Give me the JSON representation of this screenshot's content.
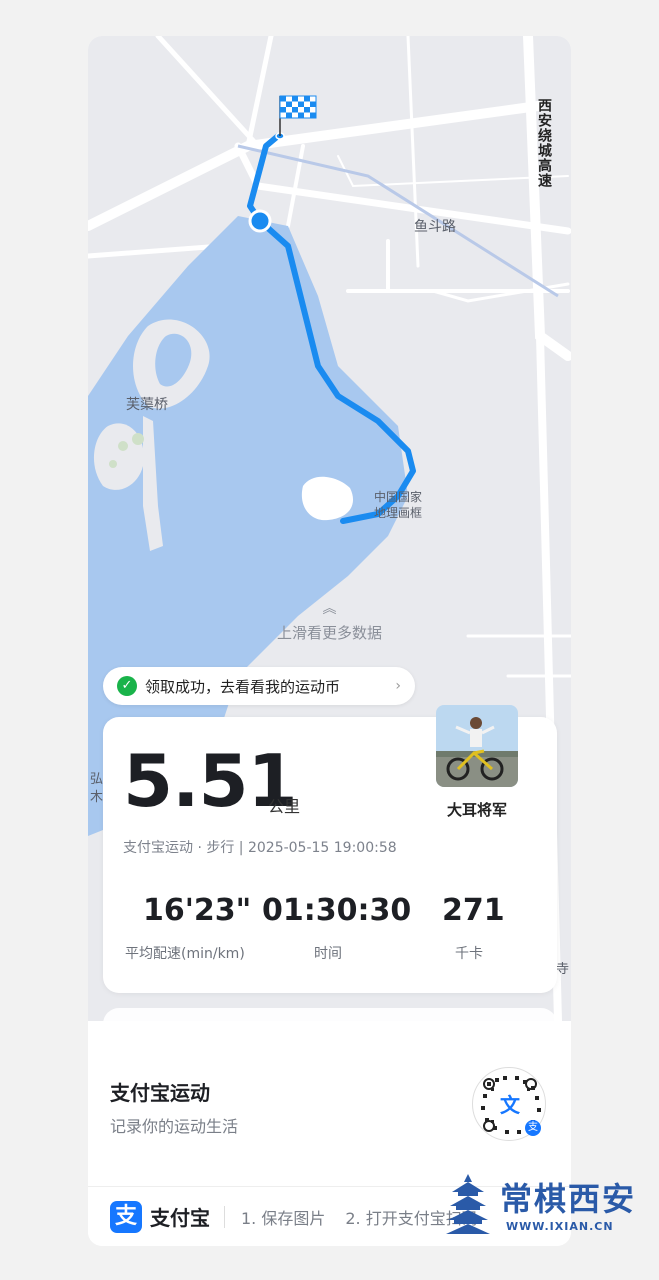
{
  "map": {
    "labels": {
      "highway": "西安绕城高速",
      "road": "鱼斗路",
      "bridge": "芙蕖桥",
      "landmark_line1": "中国国家",
      "landmark_line2": "地理画框",
      "edge_left_1": "弘",
      "edge_left_2": "木",
      "edge_right": "寺"
    },
    "swipe_hint": "上滑看更多数据"
  },
  "coin_pill": {
    "text": "领取成功，去看看我的运动币"
  },
  "stats": {
    "distance": "5.51",
    "distance_unit": "公里",
    "meta": "支付宝运动 · 步行 | 2025-05-15 19:00:58",
    "username": "大耳将军",
    "metrics": [
      {
        "value": "16'23\"",
        "label": "平均配速(min/km)"
      },
      {
        "value": "01:30:30",
        "label": "时间"
      },
      {
        "value": "271",
        "label": "千卡"
      }
    ]
  },
  "footer": {
    "app_title": "支付宝运动",
    "app_subtitle": "记录你的运动生活",
    "qr_glyph": "文",
    "qr_badge": "支",
    "logo_glyph": "支",
    "brand": "支付宝",
    "steps": [
      "1. 保存图片",
      "2. 打开支付宝扫码"
    ]
  },
  "watermark": {
    "text": "常棋西安",
    "url": "WWW.IXIAN.CN"
  },
  "colors": {
    "water": "#a8c8ef",
    "route": "#1a8bf0",
    "accent": "#1677ff"
  }
}
